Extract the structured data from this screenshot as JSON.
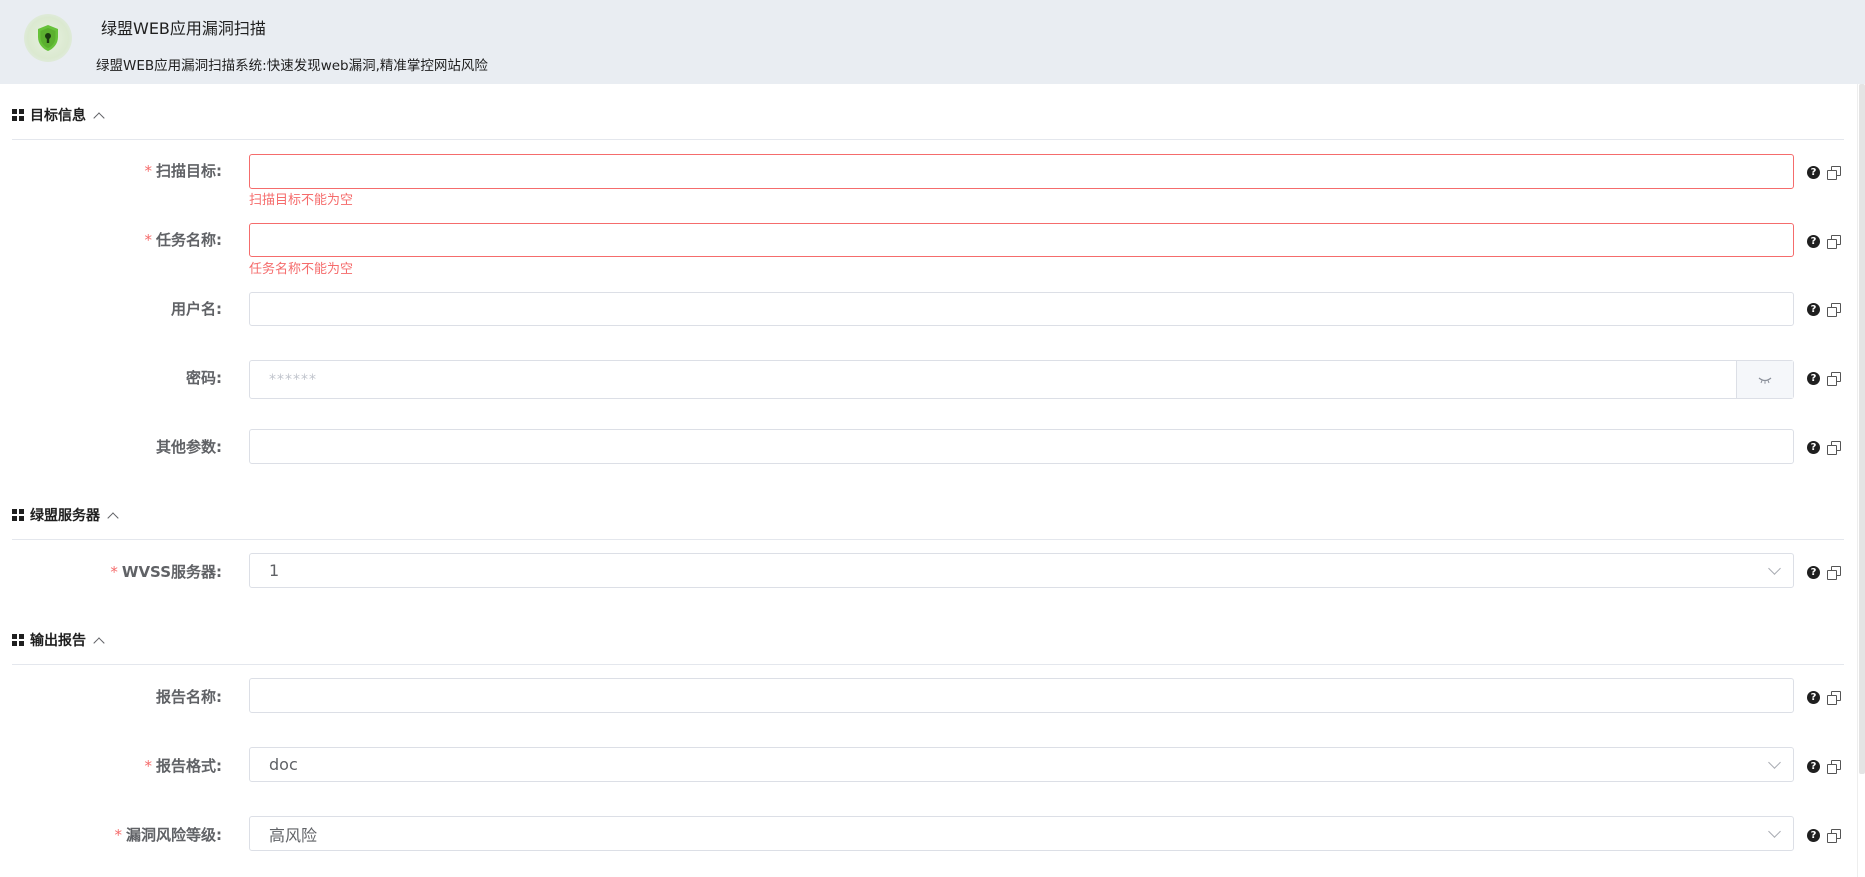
{
  "header": {
    "title": "绿盟WEB应用漏洞扫描",
    "subtitle": "绿盟WEB应用漏洞扫描系统:快速发现web漏洞,精准掌控网站风险",
    "logo_icon": "shield-keyhole-icon",
    "accent": "#67c23a"
  },
  "sections": {
    "target": {
      "title": "目标信息"
    },
    "server": {
      "title": "绿盟服务器"
    },
    "report": {
      "title": "输出报告"
    }
  },
  "required_mark": "*",
  "fields": {
    "scan_target": {
      "label": "扫描目标:",
      "value": "",
      "error": "扫描目标不能为空"
    },
    "task_name": {
      "label": "任务名称:",
      "value": "",
      "error": "任务名称不能为空"
    },
    "username": {
      "label": "用户名:",
      "value": ""
    },
    "password": {
      "label": "密码:",
      "placeholder": "******"
    },
    "other_params": {
      "label": "其他参数:",
      "value": ""
    },
    "wvss_server": {
      "label": "WVSS服务器:",
      "value": "1"
    },
    "report_name": {
      "label": "报告名称:",
      "value": ""
    },
    "report_format": {
      "label": "报告格式:",
      "value": "doc"
    },
    "risk_level": {
      "label": "漏洞风险等级:",
      "value": "高风险"
    }
  },
  "icons": {
    "help": "?",
    "copy": "copy-icon",
    "eye": "eye-closed-icon"
  },
  "colors": {
    "error": "#f56c6c",
    "border": "#dcdfe6",
    "header_bg": "#e9edf2"
  }
}
